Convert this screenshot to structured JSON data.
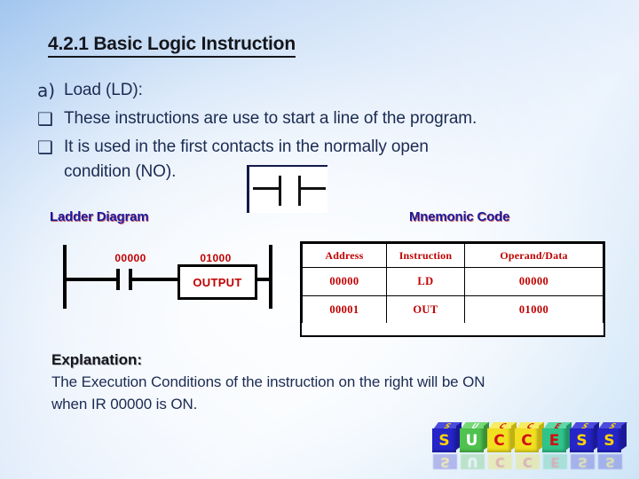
{
  "slide": {
    "title": "4.2.1 Basic Logic Instruction",
    "background_top_left": "#9dc3ee",
    "background_center": "#ffffff"
  },
  "bullets": [
    {
      "marker": "a)",
      "text": "Load (LD):",
      "line2": ""
    },
    {
      "marker": "❑",
      "text": "These instructions are use to start a line of the program.",
      "line2": ""
    },
    {
      "marker": "❑",
      "text": "It is used in the first contacts in the normally open",
      "line2": "condition (NO)."
    }
  ],
  "contact_symbol": {
    "name": "normally-open-contact",
    "box_fill": "#ffffff",
    "line_color": "#111111"
  },
  "captions": {
    "ladder": "Ladder Diagram",
    "mnemonic": "Mnemonic Code",
    "color": "#1a1a9c",
    "shadow_color": "#be0000"
  },
  "ladder": {
    "contact_label": "00000",
    "coil_label": "01000",
    "coil_box_text": "OUTPUT",
    "label_color": "#c00000",
    "line_color": "#000000"
  },
  "mnemonic_table": {
    "headers": [
      "Address",
      "Instruction",
      "Operand/Data"
    ],
    "rows": [
      [
        "00000",
        "LD",
        "00000"
      ],
      [
        "00001",
        "OUT",
        "01000"
      ]
    ],
    "text_color": "#c00000",
    "border_color": "#000000"
  },
  "explanation": {
    "heading": "Explanation:",
    "line1": "The Execution Conditions of the instruction on the right will be ON",
    "line2": "when IR 00000 is ON."
  },
  "success_logo": {
    "word": "SUCCESS",
    "cubes": [
      {
        "letter": "S",
        "cube_color": "#2525c8",
        "letter_color": "#ffd500",
        "top_color": "#4a4ade",
        "side_color": "#1a1a96"
      },
      {
        "letter": "U",
        "cube_color": "#4fc24f",
        "letter_color": "#ffffff",
        "top_color": "#74d874",
        "side_color": "#399139"
      },
      {
        "letter": "C",
        "cube_color": "#f2e020",
        "letter_color": "#d01010",
        "top_color": "#f7ec62",
        "side_color": "#c0b014"
      },
      {
        "letter": "C",
        "cube_color": "#f2e020",
        "letter_color": "#d01010",
        "top_color": "#f7ec62",
        "side_color": "#c0b014"
      },
      {
        "letter": "E",
        "cube_color": "#2fc48a",
        "letter_color": "#d01010",
        "top_color": "#5fd8a8",
        "side_color": "#22946a"
      },
      {
        "letter": "S",
        "cube_color": "#2525c8",
        "letter_color": "#ffd500",
        "top_color": "#4a4ade",
        "side_color": "#1a1a96"
      },
      {
        "letter": "S",
        "cube_color": "#2525c8",
        "letter_color": "#ffd500",
        "top_color": "#4a4ade",
        "side_color": "#1a1a96"
      }
    ]
  }
}
